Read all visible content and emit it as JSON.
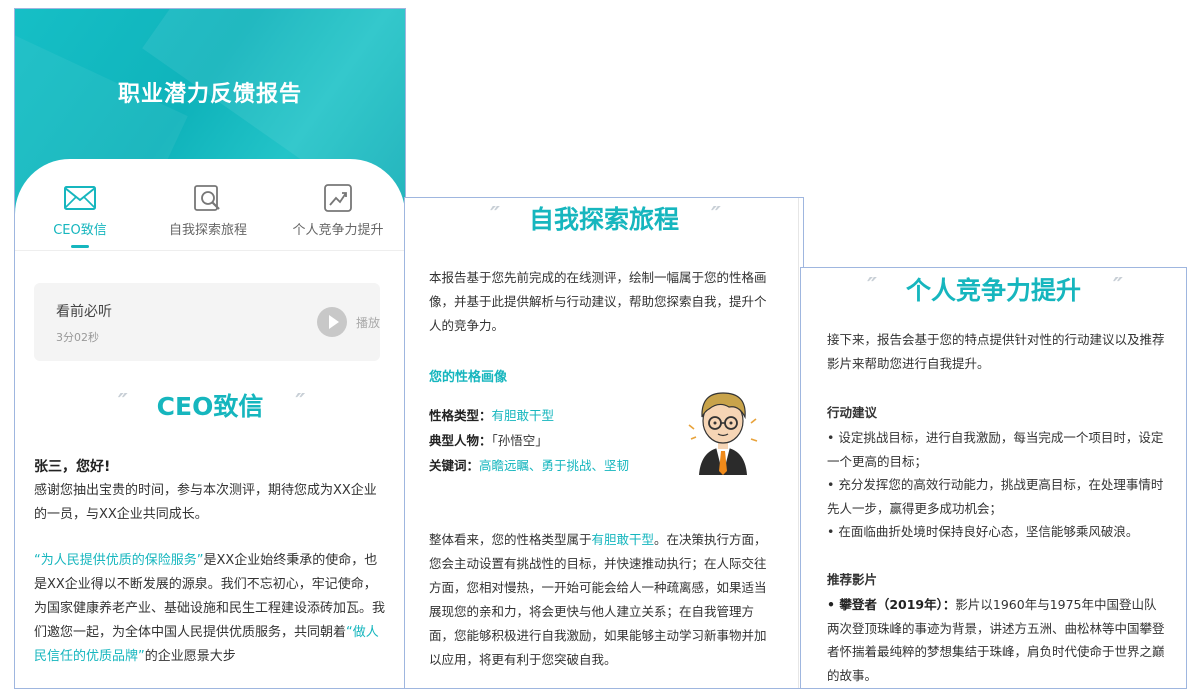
{
  "panel1": {
    "title": "职业潜力反馈报告",
    "tabs": [
      {
        "label": "CEO致信",
        "icon": "envelope-icon",
        "active": true
      },
      {
        "label": "自我探索旅程",
        "icon": "magnifier-icon",
        "active": false
      },
      {
        "label": "个人竞争力提升",
        "icon": "growth-chart-icon",
        "active": false
      }
    ],
    "audio": {
      "title": "看前必听",
      "duration": "3分02秒",
      "play_label": "播放"
    },
    "section_title": "CEO致信",
    "greeting": "张三，您好!",
    "para1": "感谢您抽出宝贵的时间，参与本次测评，期待您成为XX企业的一员，与XX企业共同成长。",
    "para2_quote": "“为人民提供优质的保险服务”",
    "para2_rest": "是XX企业始终秉承的使命，也是XX企业得以不断发展的源泉。我们不忘初心，牢记使命，为国家健康养老产业、基础设施和民生工程建设添砖加瓦。我们邀您一起，为全体中国人民提供优质服务，共同朝着",
    "para2_quote2": "“做人民信任的优质品牌”",
    "para2_tail": "的企业愿景大步"
  },
  "panel2": {
    "section_title": "自我探索旅程",
    "intro": "本报告基于您先前完成的在线测评，绘制一幅属于您的性格画像，并基于此提供解析与行动建议，帮助您探索自我，提升个人的竞争力。",
    "portrait_heading": "您的性格画像",
    "type_label": "性格类型：",
    "type_value": "有胆敢干型",
    "person_label": "典型人物：",
    "person_value": "「孙悟空」",
    "keywords_label": "关键词：",
    "keywords_value": "高瞻远瞩、勇于挑战、坚韧",
    "summary_a": "整体看来，您的性格类型属于",
    "summary_type": "有胆敢干型",
    "summary_b": "。在决策执行方面，您会主动设置有挑战性的目标，并快速推动执行；在人际交往方面，您相对慢热，一开始可能会给人一种疏离感，如果适当展现您的亲和力，将会更快与他人建立关系；在自我管理方面，您能够积极进行自我激励，如果能够主动学习新事物并加以应用，将更有利于您突破自我。"
  },
  "panel3": {
    "section_title": "个人竞争力提升",
    "intro": "接下来，报告会基于您的特点提供针对性的行动建议以及推荐影片来帮助您进行自我提升。",
    "action_heading": "行动建议",
    "actions": [
      "• 设定挑战目标，进行自我激励，每当完成一个项目时，设定一个更高的目标；",
      "• 充分发挥您的高效行动能力，挑战更高目标，在处理事情时先人一步，赢得更多成功机会；",
      "• 在面临曲折处境时保持良好心态，坚信能够乘风破浪。"
    ],
    "movie_heading": "推荐影片",
    "movie_title": "• 攀登者（2019年）：",
    "movie_desc": "影片以1960年与1975年中国登山队两次登顶珠峰的事迹为背景，讲述方五洲、曲松林等中国攀登者怀揣着最纯粹的梦想集结于珠峰，肩负时代使命于世界之巅的故事。"
  },
  "colors": {
    "accent": "#16b6be",
    "border": "#9fb6df"
  }
}
